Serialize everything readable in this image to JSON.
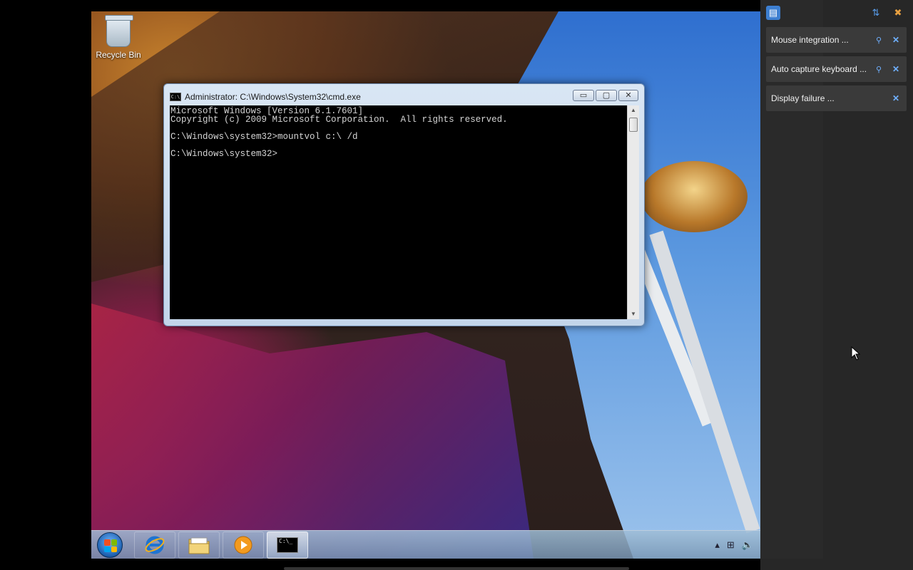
{
  "desktop": {
    "icons": [
      {
        "label": "Recycle Bin",
        "icon": "recycle-bin-icon"
      }
    ]
  },
  "cmd_window": {
    "title": "Administrator: C:\\Windows\\System32\\cmd.exe",
    "console_text": "Microsoft Windows [Version 6.1.7601]\nCopyright (c) 2009 Microsoft Corporation.  All rights reserved.\n\nC:\\Windows\\system32>mountvol c:\\ /d\n\nC:\\Windows\\system32>",
    "buttons": {
      "minimize": "▭",
      "maximize": "▢",
      "close": "✕"
    }
  },
  "taskbar": {
    "items": [
      {
        "name": "start-button",
        "icon": "windows-logo-icon"
      },
      {
        "name": "internet-explorer",
        "icon": "ie-icon"
      },
      {
        "name": "file-explorer",
        "icon": "folder-icon"
      },
      {
        "name": "media-player",
        "icon": "media-player-icon"
      },
      {
        "name": "command-prompt",
        "icon": "cmd-icon",
        "active": true
      }
    ],
    "tray_icons": [
      "show-hidden-icons-icon",
      "network-icon",
      "volume-icon"
    ],
    "tray_glyphs": {
      "up": "▴",
      "network": "⊞",
      "volume": "🔈"
    }
  },
  "sidebar": {
    "top_icons": [
      "notifications-icon",
      "sort-icon",
      "clear-all-icon"
    ],
    "notifications": [
      {
        "text": "Mouse integration ...",
        "pinnable": true
      },
      {
        "text": "Auto capture keyboard ...",
        "pinnable": true
      },
      {
        "text": "Display failure ...",
        "pinnable": false
      }
    ],
    "pin_glyph": "⚲",
    "close_glyph": "✕"
  },
  "colors": {
    "sidebar_bg": "#272727",
    "notification_bg": "#3a3a3a",
    "accent": "#6fb0ff",
    "console_bg": "#000000",
    "console_fg": "#d4d4d4"
  }
}
